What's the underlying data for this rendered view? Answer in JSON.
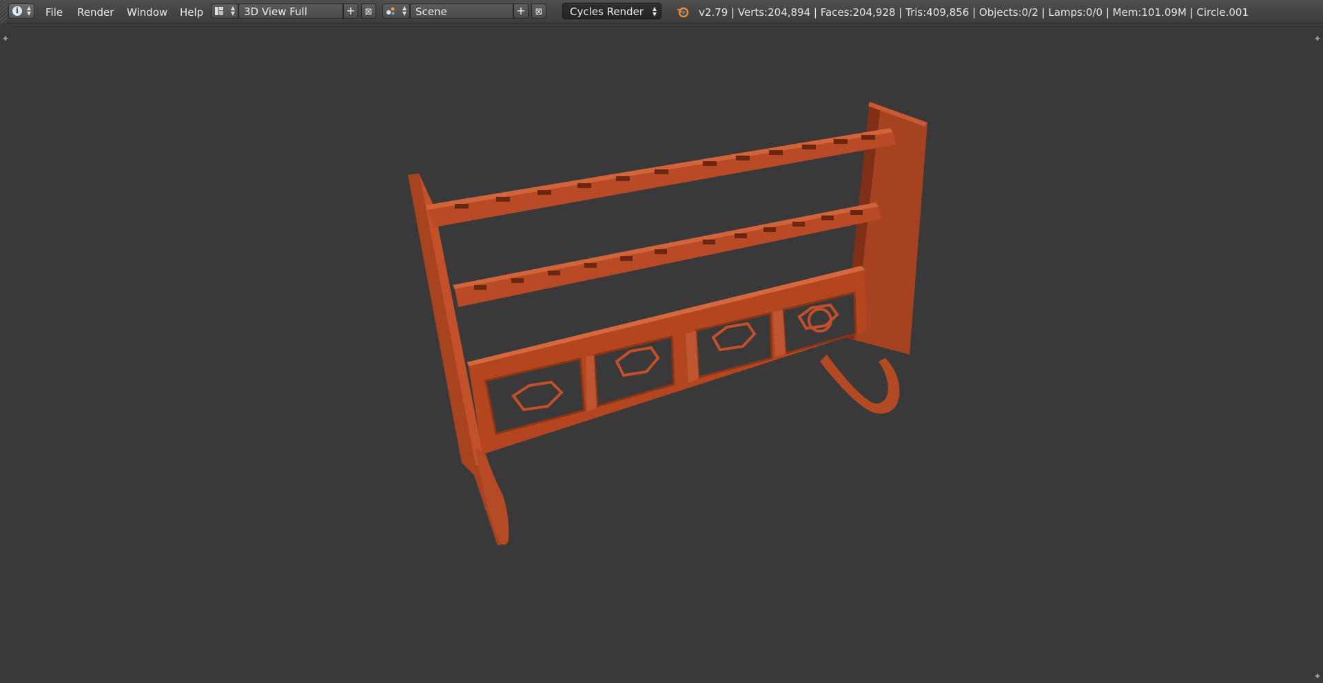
{
  "header": {
    "editor_type_icon": "info-icon",
    "menu": [
      "File",
      "Render",
      "Window",
      "Help"
    ],
    "screen_layout": {
      "icon": "screen-layout-icon",
      "value": "3D View Full"
    },
    "scene": {
      "icon": "scene-icon",
      "value": "Scene"
    },
    "add_icon": "plus-icon",
    "remove_icon": "x-icon",
    "render_engine": "Cycles Render",
    "stats": "v2.79 | Verts:204,894 | Faces:204,928 | Tris:409,856 | Objects:0/2 | Lamps:0/0 | Mem:101.09M | Circle.001"
  },
  "viewport": {
    "background_color": "#393939",
    "model_color": "#c4502a",
    "object_name": "Circle.001"
  }
}
